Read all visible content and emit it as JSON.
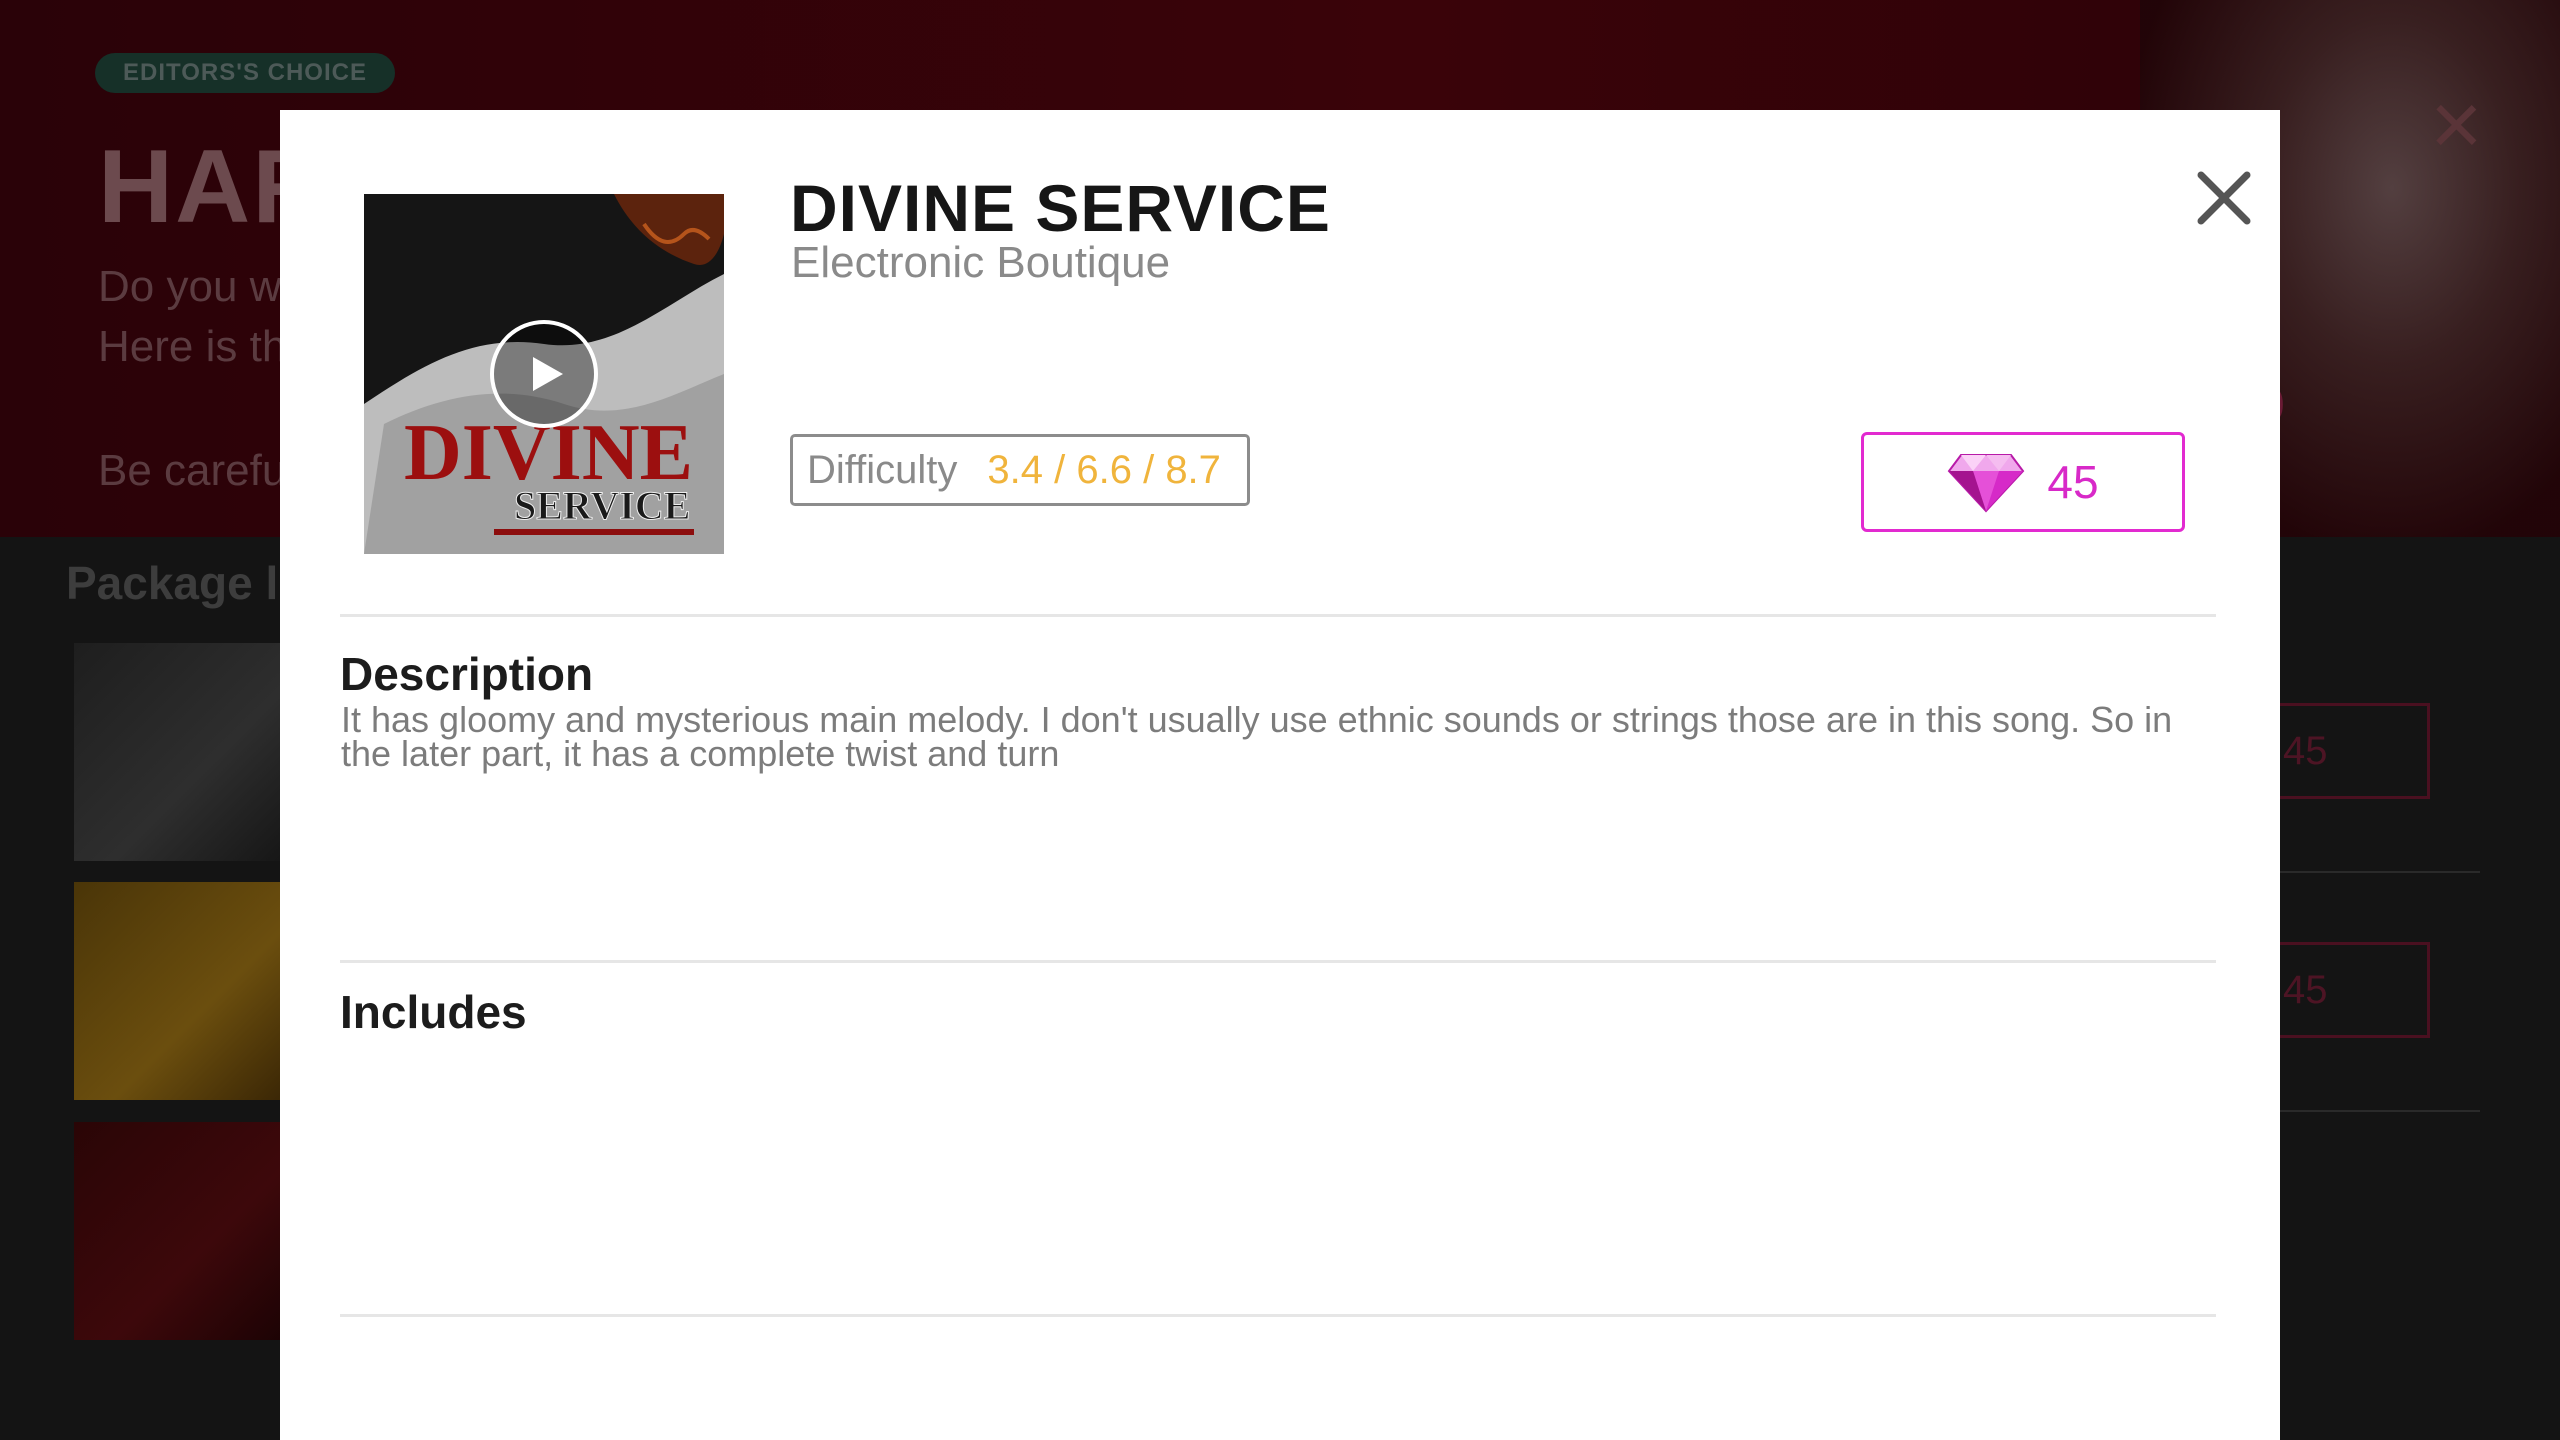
{
  "background": {
    "badge": "EDITORS'S CHOICE",
    "title": "HAR",
    "lines": [
      "Do you w",
      "Here is th",
      "Be carefu"
    ],
    "coin_fragment": "0",
    "package_header": "Package li",
    "prices": [
      "45",
      "45"
    ]
  },
  "modal": {
    "title": "DIVINE SERVICE",
    "artist": "Electronic Boutique",
    "difficulty": {
      "label": "Difficulty",
      "value": "3.4 / 6.6 / 8.7"
    },
    "price": {
      "amount": "45",
      "currency_icon": "gem-icon"
    },
    "cover": {
      "text_line1": "DIVINE",
      "text_line2": "SERVICE"
    },
    "description": {
      "heading": "Description",
      "text": "It has gloomy and mysterious main melody. I don't usually use ethnic sounds or strings those are in this song. So in the later part, it has a complete twist and turn"
    },
    "includes": {
      "heading": "Includes"
    }
  },
  "colors": {
    "accent": "#e22ad0",
    "difficulty_value": "#f0b43c",
    "title": "#161616",
    "muted": "#8a8a8a"
  }
}
